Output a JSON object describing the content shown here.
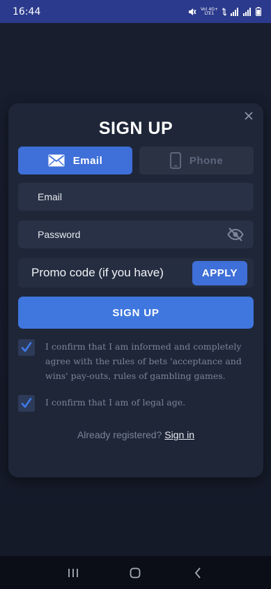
{
  "status_bar": {
    "time": "16:44",
    "net_top": "Vo) 4G+",
    "net_bottom": "LTE1"
  },
  "modal": {
    "title": "SIGN UP",
    "close_glyph": "×",
    "tabs": [
      {
        "label": "Email",
        "icon": "envelope-icon",
        "active": true
      },
      {
        "label": "Phone",
        "icon": "phone-icon",
        "active": false
      }
    ],
    "email_placeholder": "Email",
    "password_placeholder": "Password",
    "promo_placeholder": "Promo code (if you have)",
    "apply_label": "APPLY",
    "signup_label": "SIGN UP",
    "checks": [
      {
        "text": "I confirm that I am informed and completely agree with the rules of bets 'acceptance and wins' pay-outs, rules of gambling games.",
        "checked": true
      },
      {
        "text": "I confirm that I am of legal age.",
        "checked": true
      }
    ],
    "already_registered": "Already registered?",
    "signin_label": "Sign in"
  },
  "colors": {
    "accent": "#3f6fd8",
    "modal_bg": "#1e2638",
    "field_bg": "#283145",
    "status_bg": "#2b3a8c"
  }
}
